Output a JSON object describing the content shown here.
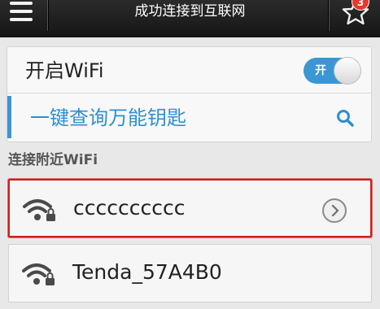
{
  "header": {
    "title": "成功连接到互联网",
    "menu_icon": "hamburger-menu-icon",
    "favorite_icon": "star-icon",
    "badge_count": "3"
  },
  "settings": {
    "wifi_label": "开启WiFi",
    "toggle_label": "开",
    "toggle_state": "on",
    "key_query_label": "一键查询万能钥匙",
    "search_icon": "search-icon",
    "accent_color": "#3a97d4"
  },
  "networks_section": {
    "title": "连接附近WiFi",
    "items": [
      {
        "name": "cccccccccc",
        "icon": "wifi-locked-icon",
        "selected": true,
        "action_icon": "chevron-right-icon"
      },
      {
        "name": "Tenda_57A4B0",
        "icon": "wifi-locked-icon",
        "selected": false
      }
    ],
    "highlight_color": "#cc1f1f"
  }
}
